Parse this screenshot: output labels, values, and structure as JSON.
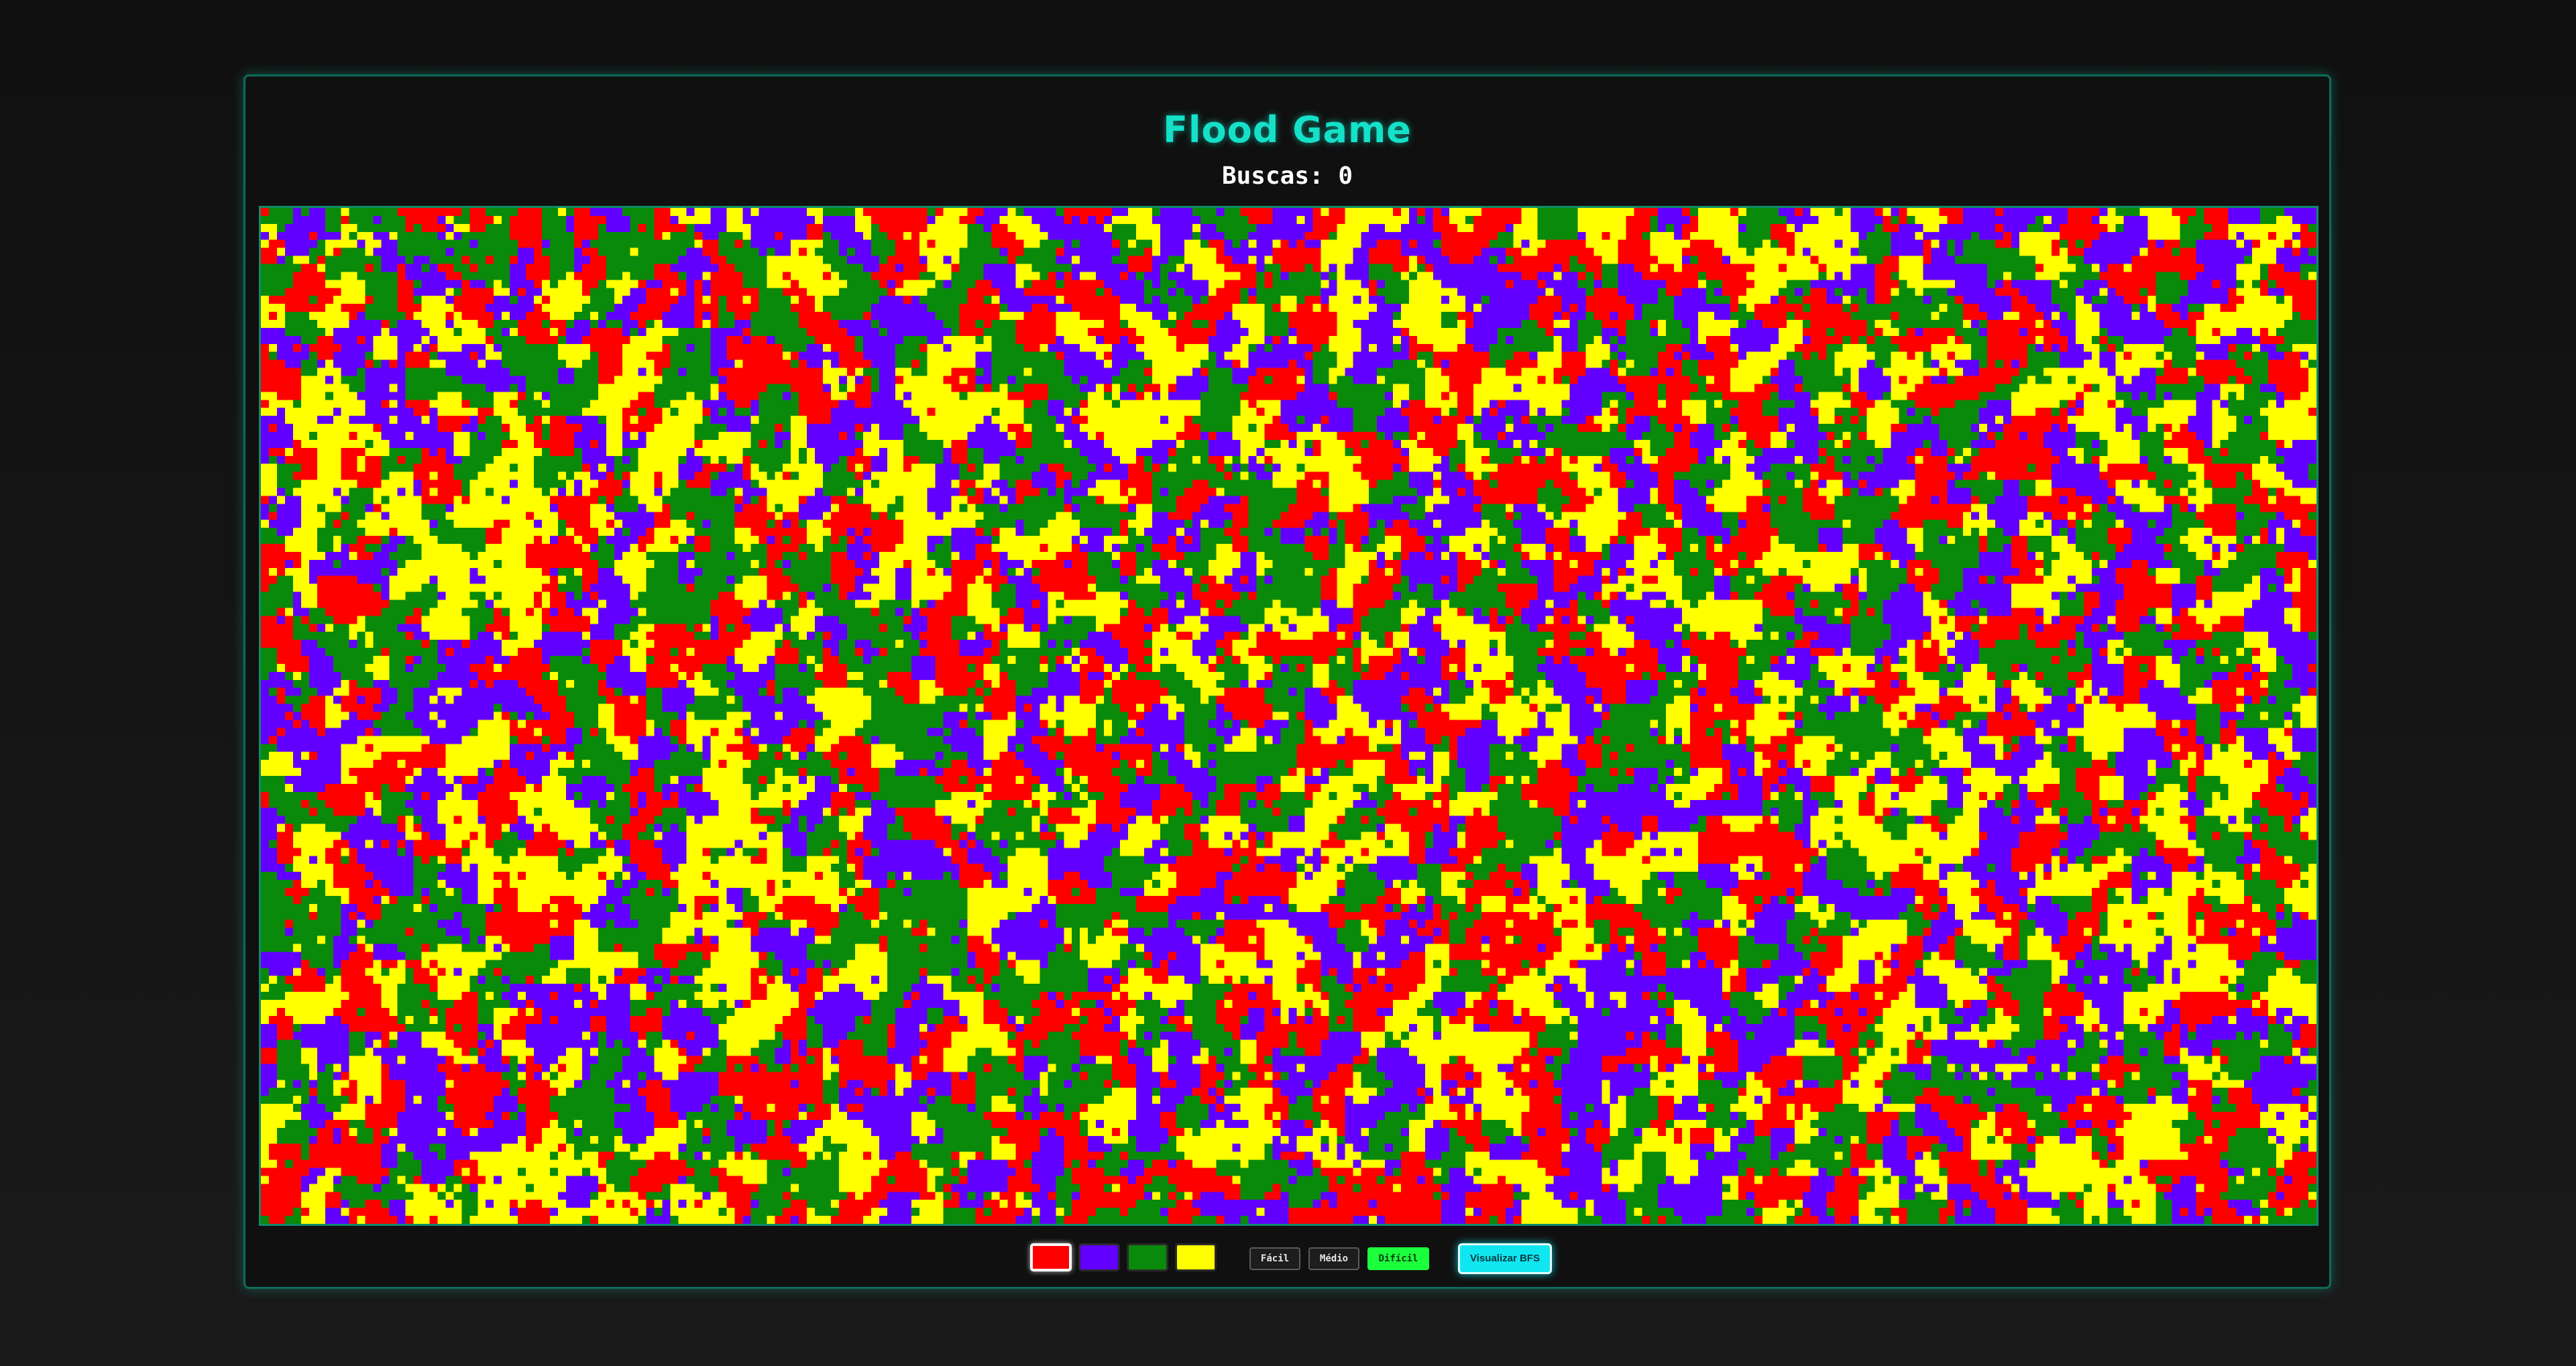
{
  "game": {
    "title": "Flood Game",
    "counter_label": "Buscas: 0",
    "board": {
      "columns": 256,
      "rows": 127,
      "palette": [
        "#ff0000",
        "#6200ff",
        "#0a8a0a",
        "#ffff00"
      ]
    }
  },
  "controls": {
    "colors": [
      {
        "name": "red",
        "hex": "#ff0000",
        "selected": true
      },
      {
        "name": "purple",
        "hex": "#6200ff",
        "selected": false
      },
      {
        "name": "green",
        "hex": "#0a8a0a",
        "selected": false
      },
      {
        "name": "yellow",
        "hex": "#ffff00",
        "selected": false
      }
    ],
    "difficulty": {
      "easy": "Fácil",
      "medium": "Médio",
      "hard": "Difícil",
      "active": "hard"
    },
    "bfs_label": "Visualizar BFS"
  }
}
